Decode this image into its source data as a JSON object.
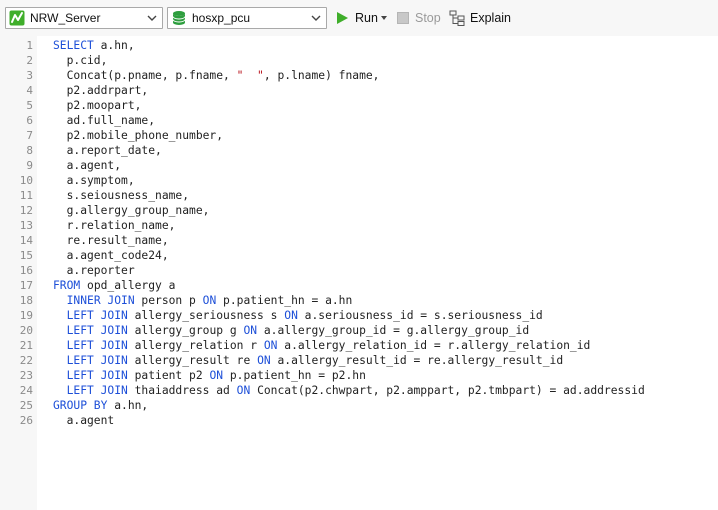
{
  "toolbar": {
    "connection": "NRW_Server",
    "database": "hosxp_pcu",
    "run_label": "Run",
    "stop_label": "Stop",
    "explain_label": "Explain"
  },
  "editor": {
    "lines": [
      [
        {
          "t": "SELECT",
          "k": 1
        },
        {
          "t": " a.hn,"
        }
      ],
      [
        {
          "t": "  p.cid,"
        }
      ],
      [
        {
          "t": "  Concat(p.pname, p.fname, "
        },
        {
          "t": "\"  \"",
          "s": 1
        },
        {
          "t": ", p.lname) fname,"
        }
      ],
      [
        {
          "t": "  p2.addrpart,"
        }
      ],
      [
        {
          "t": "  p2.moopart,"
        }
      ],
      [
        {
          "t": "  ad.full_name,"
        }
      ],
      [
        {
          "t": "  p2.mobile_phone_number,"
        }
      ],
      [
        {
          "t": "  a.report_date,"
        }
      ],
      [
        {
          "t": "  a.agent,"
        }
      ],
      [
        {
          "t": "  a.symptom,"
        }
      ],
      [
        {
          "t": "  s.seiousness_name,"
        }
      ],
      [
        {
          "t": "  g.allergy_group_name,"
        }
      ],
      [
        {
          "t": "  r.relation_name,"
        }
      ],
      [
        {
          "t": "  re.result_name,"
        }
      ],
      [
        {
          "t": "  a.agent_code24,"
        }
      ],
      [
        {
          "t": "  a.reporter"
        }
      ],
      [
        {
          "t": "FROM",
          "k": 1
        },
        {
          "t": " opd_allergy a"
        }
      ],
      [
        {
          "t": "  "
        },
        {
          "t": "INNER JOIN",
          "k": 1
        },
        {
          "t": " person p "
        },
        {
          "t": "ON",
          "k": 1
        },
        {
          "t": " p.patient_hn = a.hn"
        }
      ],
      [
        {
          "t": "  "
        },
        {
          "t": "LEFT JOIN",
          "k": 1
        },
        {
          "t": " allergy_seriousness s "
        },
        {
          "t": "ON",
          "k": 1
        },
        {
          "t": " a.seriousness_id = s.seriousness_id"
        }
      ],
      [
        {
          "t": "  "
        },
        {
          "t": "LEFT JOIN",
          "k": 1
        },
        {
          "t": " allergy_group g "
        },
        {
          "t": "ON",
          "k": 1
        },
        {
          "t": " a.allergy_group_id = g.allergy_group_id"
        }
      ],
      [
        {
          "t": "  "
        },
        {
          "t": "LEFT JOIN",
          "k": 1
        },
        {
          "t": " allergy_relation r "
        },
        {
          "t": "ON",
          "k": 1
        },
        {
          "t": " a.allergy_relation_id = r.allergy_relation_id"
        }
      ],
      [
        {
          "t": "  "
        },
        {
          "t": "LEFT JOIN",
          "k": 1
        },
        {
          "t": " allergy_result re "
        },
        {
          "t": "ON",
          "k": 1
        },
        {
          "t": " a.allergy_result_id = re.allergy_result_id"
        }
      ],
      [
        {
          "t": "  "
        },
        {
          "t": "LEFT JOIN",
          "k": 1
        },
        {
          "t": " patient p2 "
        },
        {
          "t": "ON",
          "k": 1
        },
        {
          "t": " p.patient_hn = p2.hn"
        }
      ],
      [
        {
          "t": "  "
        },
        {
          "t": "LEFT JOIN",
          "k": 1
        },
        {
          "t": " thaiaddress ad "
        },
        {
          "t": "ON",
          "k": 1
        },
        {
          "t": " Concat(p2.chwpart, p2.amppart, p2.tmbpart) = ad.addressid"
        }
      ],
      [
        {
          "t": "GROUP BY",
          "k": 1
        },
        {
          "t": " a.hn,"
        }
      ],
      [
        {
          "t": "  a.agent"
        }
      ]
    ]
  },
  "icons": {
    "connection": "server-connection-icon",
    "database": "database-icon",
    "run": "play-icon",
    "stop": "stop-icon",
    "explain": "explain-icon",
    "dropdown": "chevron-down-icon"
  },
  "colors": {
    "keyword": "#1d4fd8",
    "string": "#b8121b",
    "run_green": "#3fae2a",
    "database_green": "#2e9e3e",
    "gutter": "#f7f7f7"
  }
}
